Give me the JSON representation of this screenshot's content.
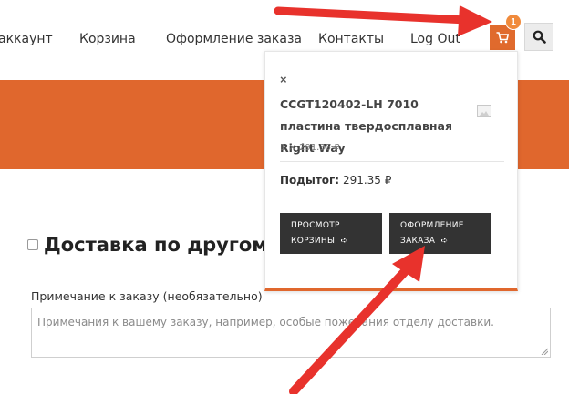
{
  "nav": {
    "items": [
      "аккаунт",
      "Корзина",
      "Оформление заказа",
      "Контакты",
      "Log Out"
    ]
  },
  "cart": {
    "count": "1",
    "icon": "cart-icon"
  },
  "search": {
    "icon": "search-icon"
  },
  "mini_cart": {
    "remove": "×",
    "product_name": "CCGT120402-LH 7010 пластина твердосплавная Right Way",
    "product_qty": "1 × 291.35 ₽",
    "subtotal_label": "Подытог:",
    "subtotal_value": "291.35 ₽",
    "view_cart_line1": "ПРОСМОТР",
    "view_cart_line2": "КОРЗИНЫ",
    "checkout_line1": "ОФОРМЛЕНИЕ",
    "checkout_line2": "ЗАКАЗА"
  },
  "checkout": {
    "ship_to_different": "Доставка по другому адр",
    "notes_label": "Примечание к заказу (необязательно)",
    "notes_placeholder": "Примечания к вашему заказу, например, особые пожелания отделу доставки."
  },
  "colors": {
    "accent": "#e0672d",
    "button_dark": "#333333",
    "arrow": "#e8322c"
  }
}
